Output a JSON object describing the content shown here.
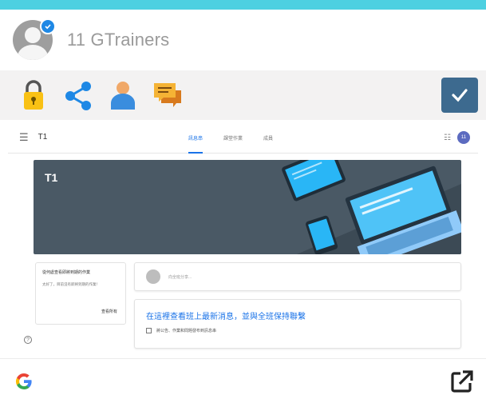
{
  "header": {
    "title": "11 GTrainers"
  },
  "toolbar": {
    "icons": [
      "lock-icon",
      "share-icon",
      "person-icon",
      "chat-icon"
    ],
    "check_icon": "check-icon",
    "accent": "#3d6a8f"
  },
  "classroom": {
    "class_name": "T1",
    "tabs": [
      "訊息串",
      "課堂作業",
      "成員"
    ],
    "active_tab": "訊息串",
    "user_initials": "11",
    "banner_title": "T1",
    "side_card": {
      "title": "從何處查看即將到期的作業",
      "body": "太好了，目前沒有即將到期的作業！",
      "link": "查看所有"
    },
    "post_placeholder": "向全班分享...",
    "info_title": "在這裡查看班上最新消息，並與全班保持聯繫",
    "info_sub": "將公告、作業和問題發布到訊息串"
  },
  "footer": {
    "logo": "G",
    "open_icon": "open-external-icon"
  },
  "colors": {
    "top_bar": "#4dd0e1",
    "banner": "#4a5965",
    "link": "#1a73e8"
  }
}
